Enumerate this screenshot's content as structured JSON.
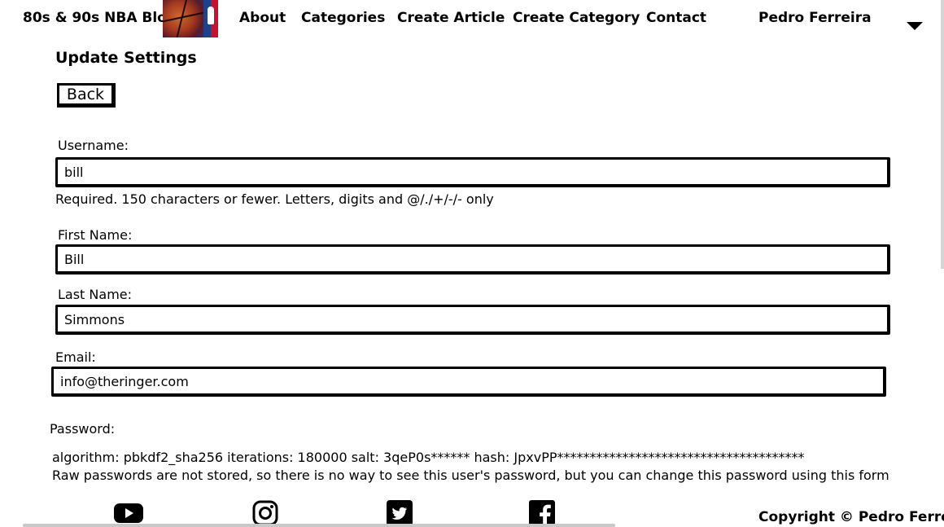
{
  "nav": {
    "brand": "80s & 90s NBA Blog",
    "links": [
      {
        "label": "About"
      },
      {
        "label": "Categories"
      },
      {
        "label": "Create Article"
      },
      {
        "label": "Create Category"
      },
      {
        "label": "Contact"
      }
    ],
    "user": "Pedro Ferreira",
    "dropdown_icon": "triangle-down-icon"
  },
  "main": {
    "title": "Update Settings",
    "back_label": "Back",
    "username": {
      "label": "Username:",
      "value": "bill",
      "help": "Required. 150 characters or fewer. Letters, digits and @/./+/-/- only"
    },
    "first_name": {
      "label": "First Name:",
      "value": "Bill"
    },
    "last_name": {
      "label": "Last Name:",
      "value": "Simmons"
    },
    "email": {
      "label": "Email:",
      "value": "info@theringer.com"
    },
    "password": {
      "label": "Password:",
      "info": "algorithm: pbkdf2_sha256 iterations: 180000 salt: 3qeP0s****** hash: JpxvPP**************************************",
      "note": "Raw passwords are not stored, so there is no way to see this user's password, but you can change this password using this form"
    }
  },
  "footer": {
    "social": [
      {
        "icon": "youtube-icon"
      },
      {
        "icon": "instagram-icon"
      },
      {
        "icon": "twitter-icon"
      },
      {
        "icon": "facebook-icon"
      }
    ],
    "copyright": "Copyright © Pedro Ferreira"
  }
}
